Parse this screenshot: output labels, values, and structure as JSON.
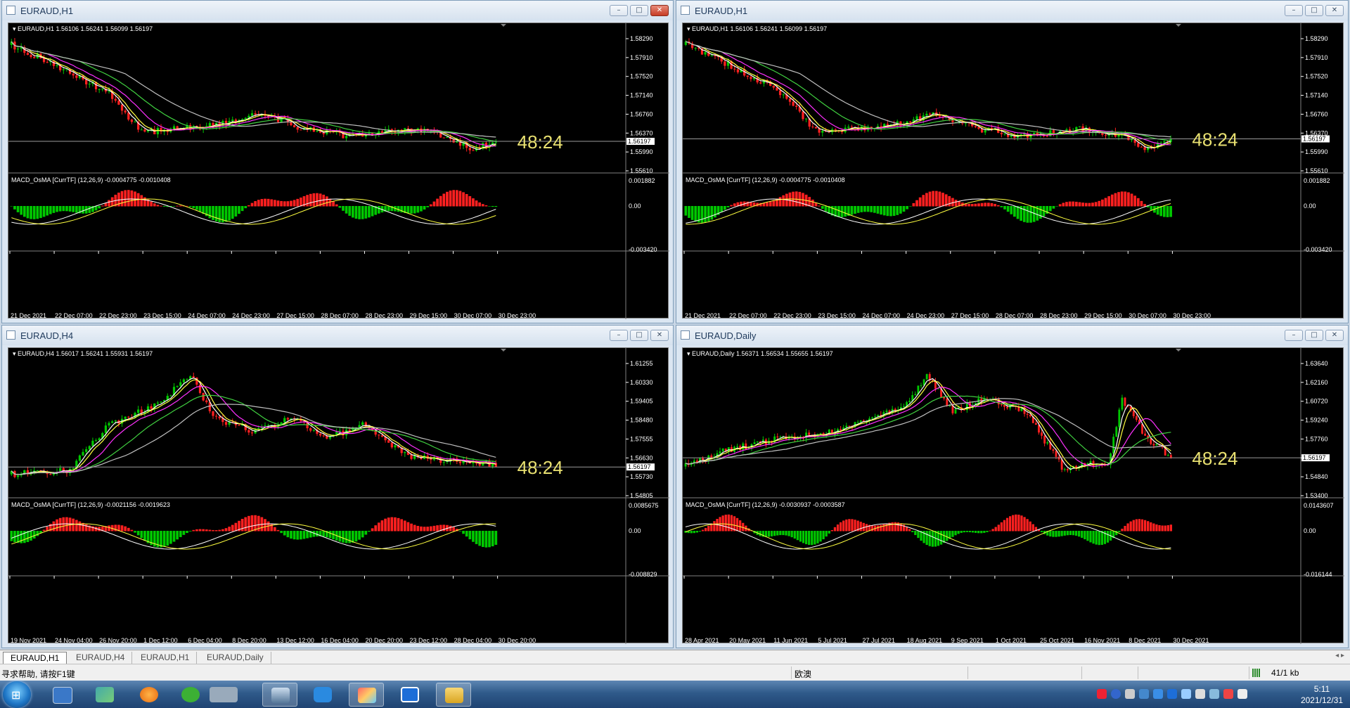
{
  "windows": [
    {
      "title": "EURAUD,H1",
      "header": "EURAUD,H1  1.56106 1.56241 1.56099 1.56197",
      "price_labels": [
        "1.58290",
        "1.57910",
        "1.57520",
        "1.57140",
        "1.56760",
        "1.56370",
        "1.55990",
        "1.55610"
      ],
      "current_price": "1.56197",
      "timer": "48:24",
      "macd_header": "MACD_OsMA [CurrTF] (12,26,9) -0.0004775 -0.0010408",
      "macd_labels": [
        "0.001882",
        "0.00",
        "-0.003420"
      ],
      "time_labels": [
        "21 Dec 2021",
        "22 Dec 07:00",
        "22 Dec 23:00",
        "23 Dec 15:00",
        "24 Dec 07:00",
        "24 Dec 23:00",
        "27 Dec 15:00",
        "28 Dec 07:00",
        "28 Dec 23:00",
        "29 Dec 15:00",
        "30 Dec 07:00",
        "30 Dec 23:00"
      ]
    },
    {
      "title": "EURAUD,H1",
      "header": "EURAUD,H1  1.56106 1.56241 1.56099 1.56197",
      "price_labels": [
        "1.58290",
        "1.57910",
        "1.57520",
        "1.57140",
        "1.56760",
        "1.56370",
        "1.55990",
        "1.55610"
      ],
      "current_price": "1.56197",
      "timer": "48:24",
      "macd_header": "MACD_OsMA [CurrTF] (12,26,9) -0.0004775 -0.0010408",
      "macd_labels": [
        "0.001882",
        "0.00",
        "-0.003420"
      ],
      "time_labels": [
        "21 Dec 2021",
        "22 Dec 07:00",
        "22 Dec 23:00",
        "23 Dec 15:00",
        "24 Dec 07:00",
        "24 Dec 23:00",
        "27 Dec 15:00",
        "28 Dec 07:00",
        "28 Dec 23:00",
        "29 Dec 15:00",
        "30 Dec 07:00",
        "30 Dec 23:00"
      ]
    },
    {
      "title": "EURAUD,H4",
      "header": "EURAUD,H4  1.56017 1.56241 1.55931 1.56197",
      "price_labels": [
        "1.61255",
        "1.60330",
        "1.59405",
        "1.58480",
        "1.57555",
        "1.56630",
        "1.55730",
        "1.54805"
      ],
      "current_price": "1.56197",
      "timer": "48:24",
      "macd_header": "MACD_OsMA [CurrTF] (12,26,9) -0.0021156 -0.0019623",
      "macd_labels": [
        "0.0085675",
        "0.00",
        "-0.008829"
      ],
      "time_labels": [
        "19 Nov 2021",
        "24 Nov 04:00",
        "26 Nov 20:00",
        "1 Dec 12:00",
        "6 Dec 04:00",
        "8 Dec 20:00",
        "13 Dec 12:00",
        "16 Dec 04:00",
        "20 Dec 20:00",
        "23 Dec 12:00",
        "28 Dec 04:00",
        "30 Dec 20:00"
      ]
    },
    {
      "title": "EURAUD,Daily",
      "header": "EURAUD,Daily  1.56371 1.56534 1.55655 1.56197",
      "price_labels": [
        "1.63640",
        "1.62160",
        "1.60720",
        "1.59240",
        "1.57760",
        "1.56197",
        "1.54840",
        "1.53400"
      ],
      "current_price": "1.56197",
      "timer": "48:24",
      "macd_header": "MACD_OsMA [CurrTF] (12,26,9) -0.0030937 -0.0003587",
      "macd_labels": [
        "0.0143607",
        "0.00",
        "-0.016144"
      ],
      "time_labels": [
        "28 Apr 2021",
        "20 May 2021",
        "11 Jun 2021",
        "5 Jul 2021",
        "27 Jul 2021",
        "18 Aug 2021",
        "9 Sep 2021",
        "1 Oct 2021",
        "25 Oct 2021",
        "16 Nov 2021",
        "8 Dec 2021",
        "30 Dec 2021"
      ]
    }
  ],
  "tabs": [
    "EURAUD,H1",
    "EURAUD,H4",
    "EURAUD,H1",
    "EURAUD,Daily"
  ],
  "status": {
    "help": "寻求帮助, 请按F1键",
    "profile": "欧澳",
    "traffic": "41/1 kb"
  },
  "clock": {
    "time": "5:11",
    "date": "2021/12/31"
  },
  "colors": {
    "bull_candle": "#00c800",
    "bear_candle": "#ff2020",
    "ma_white": "#ffffff",
    "ma_yellow": "#ffff40",
    "ma_magenta": "#ff30ff",
    "ma_green": "#40d040",
    "ma_gray": "#bfbfbf",
    "timer": "#e8e070"
  }
}
